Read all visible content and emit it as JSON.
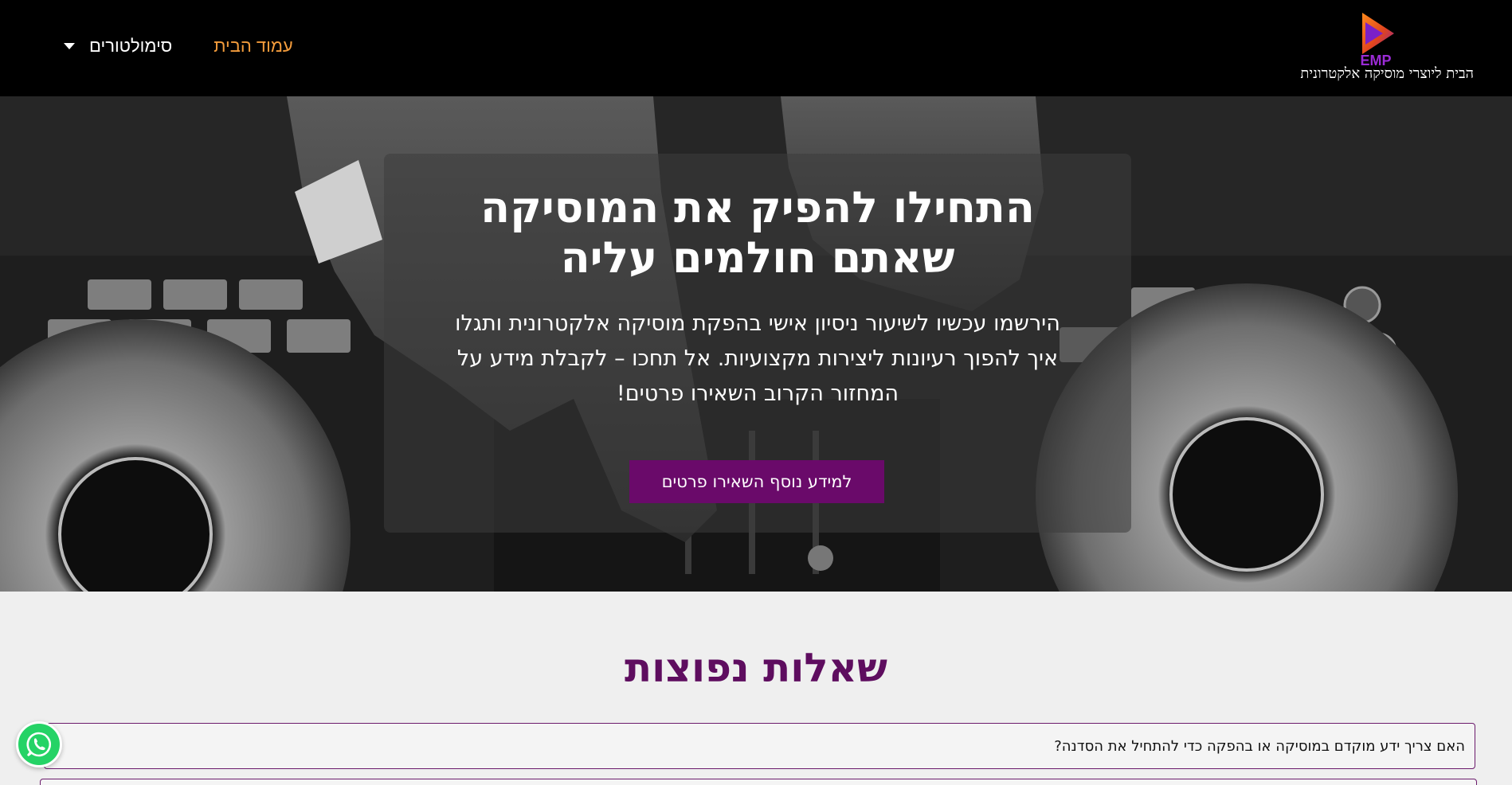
{
  "header": {
    "logo_text": "EMP",
    "logo_tagline": "הבית ליוצרי מוסיקה אלקטרונית",
    "nav": {
      "home_label": "עמוד הבית",
      "simulators_label": "סימולטורים"
    }
  },
  "hero": {
    "title_line1": "התחילו להפיק את המוסיקה",
    "title_line2": "שאתם חולמים עליה",
    "text_line1": "הירשמו עכשיו לשיעור ניסיון אישי בהפקת מוסיקה אלקטרונית ותגלו",
    "text_line2": "איך להפוך רעיונות ליצירות מקצועיות. אל תחכו – לקבלת מידע על",
    "text_line3": "המחזור הקרוב השאירו פרטים!",
    "cta_label": "למידע נוסף השאירו פרטים"
  },
  "faq": {
    "title": "שאלות נפוצות",
    "items": [
      {
        "question": "האם צריך ידע מוקדם במוסיקה או בהפקה כדי להתחיל את הסדנה?"
      }
    ]
  },
  "icons": {
    "whatsapp": "whatsapp-icon",
    "dropdown": "caret-down-icon",
    "logo": "play-triangle-logo"
  },
  "colors": {
    "header_bg": "#000000",
    "nav_active": "#f39c3c",
    "accent_purple": "#6a0a6a",
    "faq_title": "#5e0d5f",
    "whatsapp_green": "#25d366"
  }
}
